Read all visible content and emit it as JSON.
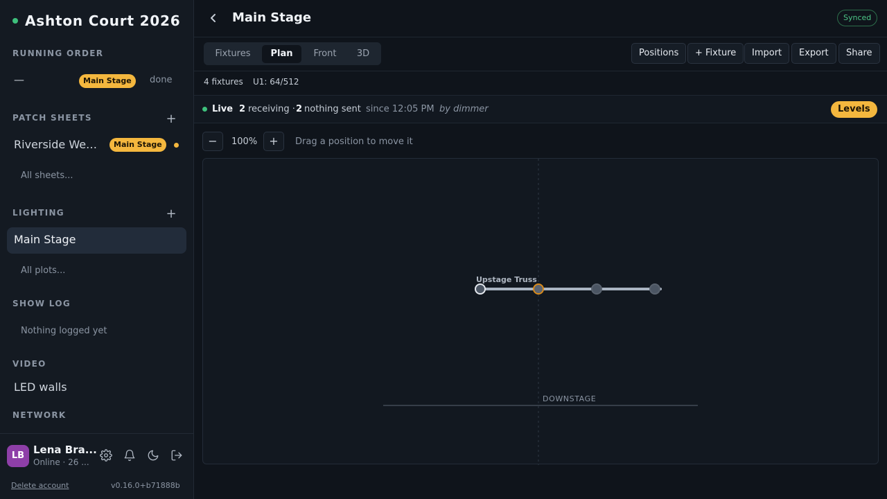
{
  "sidebar": {
    "title": "Ashton Court 2026",
    "running_order": {
      "heading": "RUNNING ORDER",
      "item": {
        "dash": "—",
        "badge": "Main Stage",
        "status": "done"
      }
    },
    "patch_sheets": {
      "heading": "PATCH SHEETS",
      "add": "+",
      "item": {
        "label": "Riverside Weekender",
        "badge": "Main Stage"
      },
      "all_link": "All sheets..."
    },
    "lighting": {
      "heading": "LIGHTING",
      "add": "+",
      "active_item": "Main Stage",
      "all_link": "All plots..."
    },
    "show_log": {
      "heading": "SHOW LOG",
      "empty": "Nothing logged yet"
    },
    "video": {
      "heading": "VIDEO",
      "item": "LED walls"
    },
    "network": {
      "heading": "NETWORK"
    },
    "user": {
      "initials": "LB",
      "name": "Lena Bra...",
      "status": "Online · 26 ..."
    },
    "delete_account": "Delete account",
    "version": "v0.16.0+b71888b"
  },
  "header": {
    "title": "Main Stage",
    "sync_status": "Synced"
  },
  "toolbar": {
    "tabs": [
      "Fixtures",
      "Plan",
      "Front",
      "3D"
    ],
    "active_tab": "Plan",
    "buttons": [
      "Positions",
      "+ Fixture",
      "Import",
      "Export",
      "Share"
    ]
  },
  "info": {
    "fixtures": "4 fixtures",
    "universe": "U1: 64/512"
  },
  "live": {
    "label": "Live",
    "receiving_count": "2",
    "receiving_text": "receiving ·",
    "nothing_count": "2",
    "nothing_text": "nothing sent",
    "since": "since 12:05 PM",
    "by": "by dimmer",
    "levels_button": "Levels"
  },
  "zoom": {
    "minus": "−",
    "value": "100%",
    "plus": "+",
    "hint": "Drag a position to move it"
  },
  "plan": {
    "position_label": "Upstage Truss",
    "downstage_label": "DOWNSTAGE",
    "fixtures": [
      {
        "state": "selected"
      },
      {
        "state": "receiving"
      },
      {
        "state": "idle"
      },
      {
        "state": "idle"
      }
    ]
  },
  "colors": {
    "accent": "#f4b73e",
    "live_green": "#3ec07c",
    "avatar": "#8e3fa8"
  }
}
